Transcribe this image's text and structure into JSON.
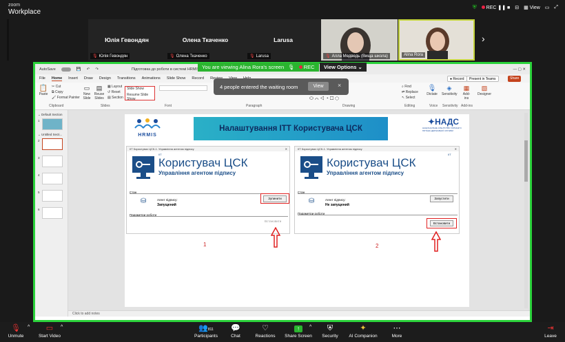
{
  "app": {
    "line1": "zoom",
    "line2": "Workplace"
  },
  "topbar": {
    "rec": "REC",
    "view": "View"
  },
  "participants": [
    {
      "name": "Юлія Гевондян",
      "label": "Юлія Гевондян"
    },
    {
      "name": "Олена Ткаченко",
      "label": "Олена Ткаченко"
    },
    {
      "name": "Larusa",
      "label": "Larusa"
    },
    {
      "name": "",
      "label": "Алла Медведь (Вища школа)"
    },
    {
      "name": "",
      "label": "Alina Rora"
    }
  ],
  "share": {
    "banner": "You are viewing  Alina Rora's screen",
    "rec": "REC",
    "view_options": "View Options"
  },
  "toast": {
    "text": "4 people entered the waiting room",
    "view": "View",
    "close": "×"
  },
  "ppt": {
    "title": "Підготовка до роботи в системі HRMIS • Saved to this PC",
    "autosave": "AutoSave",
    "tabs": [
      "File",
      "Home",
      "Insert",
      "Draw",
      "Design",
      "Transitions",
      "Animations",
      "Slide Show",
      "Record",
      "Review",
      "View",
      "Help"
    ],
    "active_tab": "Home",
    "record": "Record",
    "present": "Present in Teams",
    "share": "Share",
    "groups": [
      "Clipboard",
      "Slides",
      "Font",
      "Paragraph",
      "Drawing",
      "Editing",
      "Voice",
      "Sensitivity",
      "Add-ins"
    ],
    "buttons": {
      "paste": "Paste",
      "cut": "Cut",
      "copy": "Copy",
      "format_painter": "Format Painter",
      "new_slide": "New Slide",
      "reuse": "Reuse Slides",
      "layout": "Layout",
      "reset": "Reset",
      "section": "Section",
      "find": "Find",
      "replace": "Replace",
      "select": "Select",
      "dictate": "Dictate",
      "sensitivity": "Sensitivity",
      "addins": "Add-ins",
      "designer": "Designer",
      "slideshow": "Slide Show",
      "resume": "Resume Slide Show"
    },
    "sections": [
      "Default Section",
      "Untitled Secti..."
    ],
    "notes": "Click to add notes"
  },
  "slide": {
    "logo": "HRMIS",
    "title": "Налаштування ІТТ Користувача ЦСК",
    "nads": "НАДС",
    "nads_sub": "НАЦІОНАЛЬНЕ АГЕНТСТВО УКРАЇНИ З ПИТАНЬ ДЕРЖАВНОЇ СЛУЖБИ",
    "left": {
      "header": "ІІТ Користувач ЦСК-1. Управління агентом підпису",
      "big": "Користувач ЦСК",
      "sub": "Управління агентом підпису",
      "iit": "ІІТ",
      "state": "Стан",
      "agent": "Агент підпису:",
      "status": "Запущений",
      "btn": "Зупинити",
      "params": "Параметри роботи",
      "install": "Встановити",
      "num": "1"
    },
    "right": {
      "header": "ІІТ Користувач ЦСК-1. Управління агентом підпису",
      "big": "Користувач ЦСК",
      "sub": "Управління агентом підпису",
      "iit": "ІІТ",
      "state": "Стан",
      "agent": "Агент підпису:",
      "status": "Не запущений",
      "btn": "Запустити",
      "params": "Параметри роботи",
      "install": "Встановити",
      "num": "2"
    }
  },
  "bottom": {
    "unmute": "Unmute",
    "video": "Start Video",
    "participants": "Participants",
    "count": "811",
    "chat": "Chat",
    "reactions": "Reactions",
    "share": "Share Screen",
    "security": "Security",
    "ai": "AI Companion",
    "more": "More",
    "leave": "Leave"
  }
}
